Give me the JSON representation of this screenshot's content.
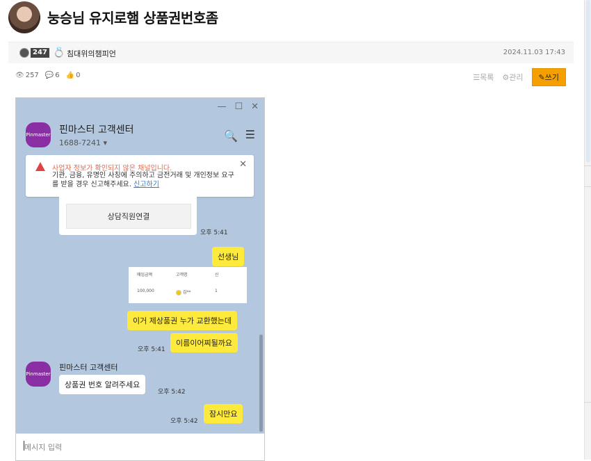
{
  "post": {
    "title": "눙승님 유지로햄 상품권번호좀",
    "level": "247",
    "author": "침대위의챔피언",
    "date": "2024.11.03 17:43",
    "views": "257",
    "comments": "6",
    "likes": "0",
    "list_label": "목록",
    "manage_label": "관리",
    "write_label": "쓰기"
  },
  "chat": {
    "logo_text": "Pinmaster",
    "name": "핀마스터 고객센터",
    "phone": "1688-7241 ▾",
    "warning_title": "사업자 정보가 확인되지 않은 채널입니다.",
    "warning_body": "기관, 금융, 유명인 사칭에 주의하고 금전거래 및 개인정보 요구를 받을 경우 신고해주세요.",
    "warning_link": "신고하기",
    "connect_button": "상담직원연결",
    "messages": [
      {
        "text": "선생님",
        "time": "오후 5:41"
      },
      {
        "text": "이거 제상품권 누가 교환했는데",
        "time": ""
      },
      {
        "text": "이름이어찌될까요",
        "time": "오후 5:41"
      },
      {
        "text": "상품권 번호 알려주세요",
        "time": "오후 5:42"
      },
      {
        "text": "잠시만요",
        "time": "오후 5:42"
      }
    ],
    "shot": {
      "headers": [
        "매입금액",
        "고객명",
        "신"
      ],
      "row": [
        "100,000",
        "김**",
        "1"
      ]
    },
    "input_placeholder": "메시지 입력"
  }
}
